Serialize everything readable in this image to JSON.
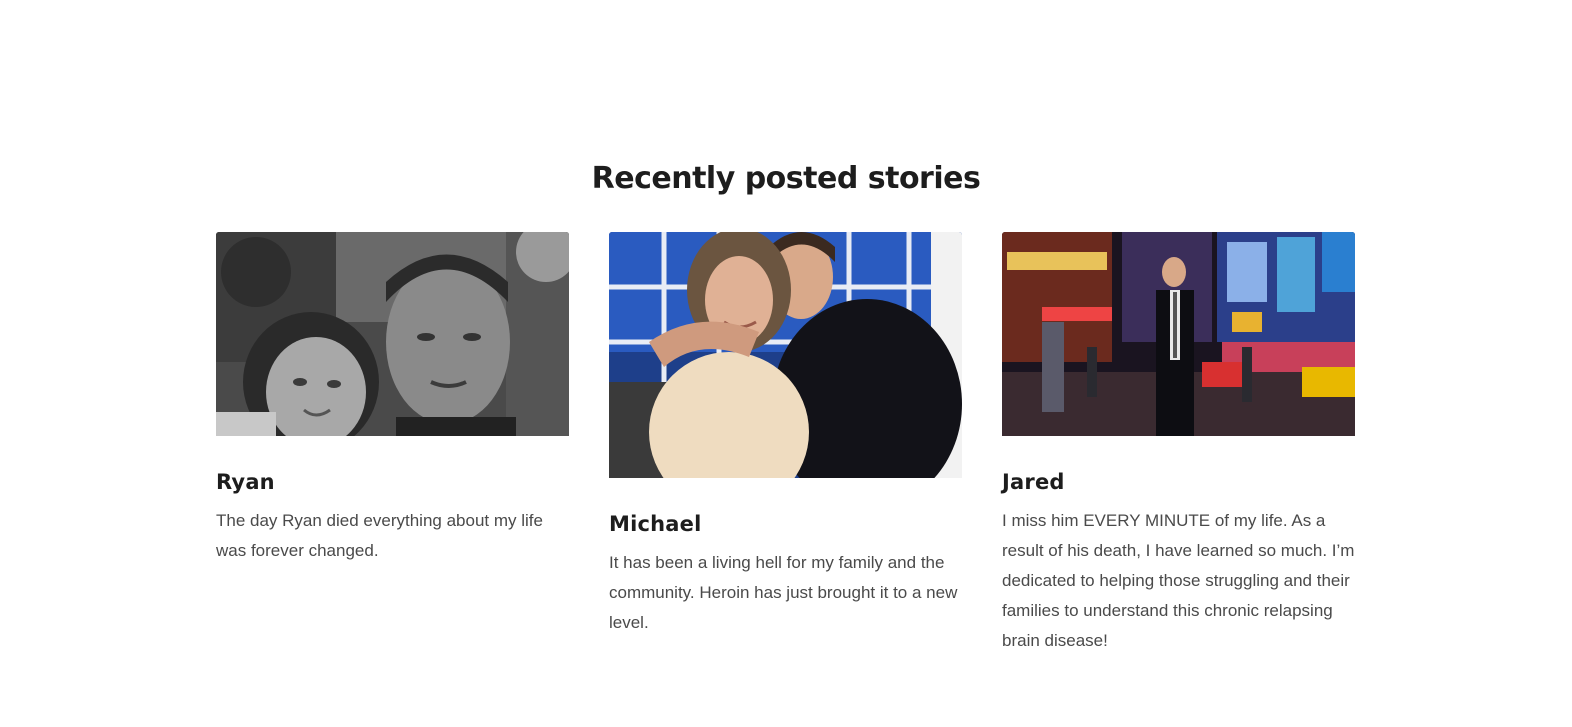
{
  "section": {
    "title": "Recently posted stories"
  },
  "stories": [
    {
      "name": "Ryan",
      "excerpt": "The day Ryan died everything about my life was forever changed.",
      "image": "photo-couple-selfie-grayscale"
    },
    {
      "name": "Michael",
      "excerpt": "It has been a living hell for my family and the community. Heroin has just brought it to a new level.",
      "image": "photo-mother-and-son-hug"
    },
    {
      "name": "Jared",
      "excerpt": "I miss him EVERY MINUTE of my life. As a result of his death, I have learned so much. I’m dedicated to helping those struggling and their families to understand this chronic relapsing brain disease!",
      "image": "photo-man-in-suit-times-square"
    }
  ],
  "colors": {
    "heading": "#1d1d1d",
    "body_text": "#4a4a4a",
    "background": "#ffffff"
  }
}
